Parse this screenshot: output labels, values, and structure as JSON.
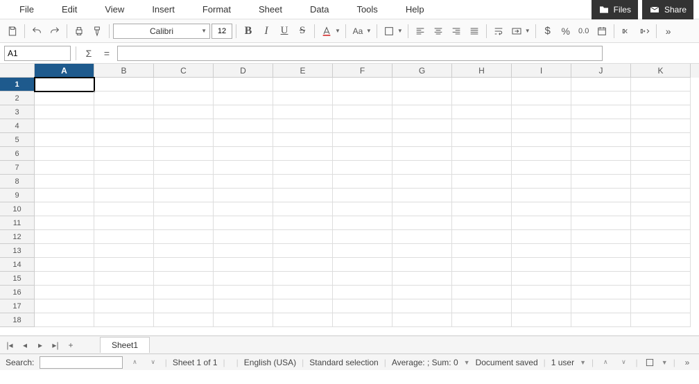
{
  "menu": {
    "items": [
      "File",
      "Edit",
      "View",
      "Insert",
      "Format",
      "Sheet",
      "Data",
      "Tools",
      "Help"
    ]
  },
  "top_buttons": {
    "files": "Files",
    "share": "Share"
  },
  "toolbar": {
    "font_name": "Calibri",
    "font_size": "12",
    "aa": "Aa"
  },
  "formula": {
    "cell_ref": "A1",
    "value": ""
  },
  "columns": [
    "A",
    "B",
    "C",
    "D",
    "E",
    "F",
    "G",
    "H",
    "I",
    "J",
    "K"
  ],
  "rows": [
    "1",
    "2",
    "3",
    "4",
    "5",
    "6",
    "7",
    "8",
    "9",
    "10",
    "11",
    "12",
    "13",
    "14",
    "15",
    "16",
    "17",
    "18"
  ],
  "sheets": {
    "tab1": "Sheet1",
    "add": "+"
  },
  "status": {
    "search_label": "Search:",
    "sheet_count": "Sheet 1 of 1",
    "language": "English (USA)",
    "selection": "Standard selection",
    "summary": "Average: ; Sum: 0",
    "saved": "Document saved",
    "users": "1 user"
  }
}
